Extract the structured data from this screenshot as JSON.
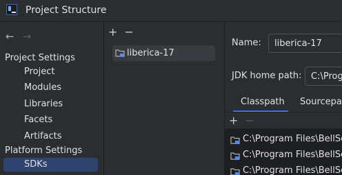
{
  "window": {
    "title": "Project Structure"
  },
  "sidebar": {
    "nav_back_glyph": "←",
    "nav_forward_glyph": "→",
    "groups": [
      {
        "header": "Project Settings",
        "items": [
          "Project",
          "Modules",
          "Libraries",
          "Facets",
          "Artifacts"
        ]
      },
      {
        "header": "Platform Settings",
        "items": [
          "SDKs"
        ]
      }
    ],
    "selected": "SDKs"
  },
  "sdk_list": {
    "add_glyph": "+",
    "remove_glyph": "−",
    "items": [
      {
        "label": "liberica-17",
        "icon": "folder-icon",
        "selected": true
      }
    ]
  },
  "details": {
    "name_label": "Name:",
    "name_value": "liberica-17",
    "jdk_home_label": "JDK home path:",
    "jdk_home_value": "C:\\Program Files\\BellSoft",
    "tabs": [
      "Classpath",
      "Sourcepath"
    ],
    "active_tab": "Classpath",
    "classpath_toolbar": {
      "add_glyph": "+",
      "remove_glyph": "−"
    },
    "classpath_entries": [
      "C:\\Program Files\\BellSoft",
      "C:\\Program Files\\BellSoft",
      "C:\\Program Files\\BellSoft"
    ]
  },
  "colors": {
    "background": "#2b2d30",
    "selection": "#2e436e",
    "list_selection": "#393b40",
    "accent": "#3574f0",
    "text": "#dfe1e5"
  }
}
